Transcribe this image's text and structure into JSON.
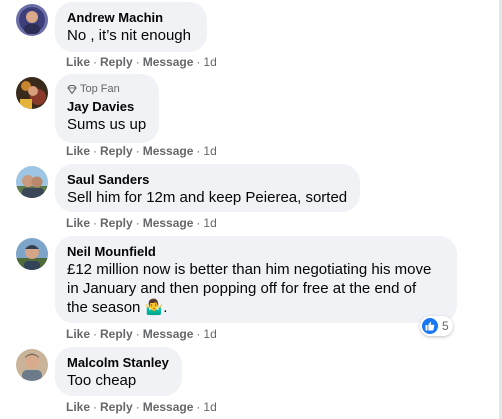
{
  "comments": [
    {
      "author": "Andrew Machin",
      "text": "No , it’s nit enough",
      "actions": {
        "like": "Like",
        "reply": "Reply",
        "message": "Message",
        "time": "1d"
      }
    },
    {
      "badge": "Top Fan",
      "author": "Jay Davies",
      "text": "Sums us up",
      "actions": {
        "like": "Like",
        "reply": "Reply",
        "message": "Message",
        "time": "1d"
      }
    },
    {
      "author": "Saul Sanders",
      "text": "Sell him for 12m and keep Peierea, sorted",
      "actions": {
        "like": "Like",
        "reply": "Reply",
        "message": "Message",
        "time": "1d"
      }
    },
    {
      "author": "Neil Mounfield",
      "text_lines": [
        "£12 million now is better than him negotiating his move",
        "in January and then popping off for free at the end of",
        "the season"
      ],
      "emoji": "🤷‍♂️",
      "text_end": ".",
      "reaction_count": "5",
      "actions": {
        "like": "Like",
        "reply": "Reply",
        "message": "Message",
        "time": "1d"
      }
    },
    {
      "author": "Malcolm Stanley",
      "text": "Too cheap",
      "actions": {
        "like": "Like",
        "reply": "Reply",
        "message": "Message",
        "time": "1d"
      }
    }
  ],
  "colors": {
    "bubble": "#f0f2f5",
    "meta_text": "#65676b",
    "like_blue": "#1877f2"
  },
  "icons": [
    "diamond-icon",
    "like-icon"
  ]
}
